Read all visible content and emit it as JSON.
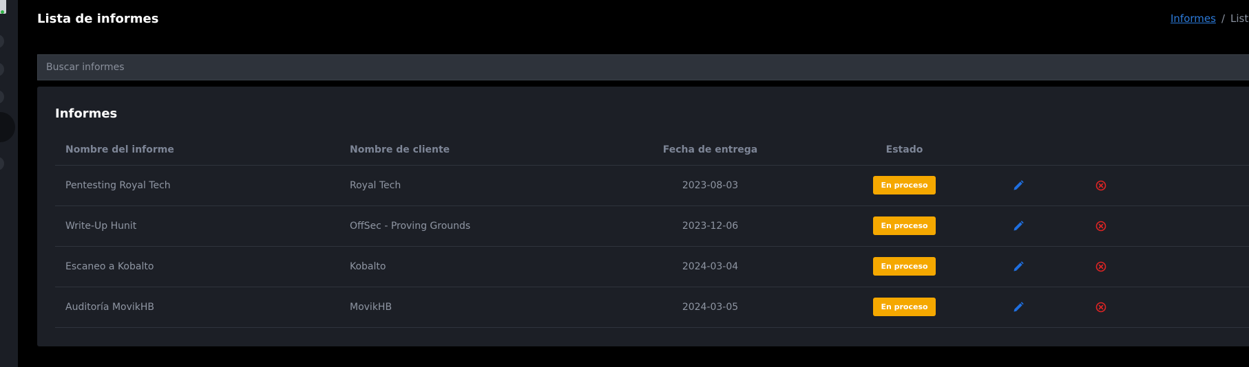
{
  "header": {
    "title": "Lista de informes",
    "breadcrumb": {
      "link": "Informes",
      "separator": "/",
      "current": "Lista"
    }
  },
  "search": {
    "placeholder": "Buscar informes",
    "value": ""
  },
  "card": {
    "title": "Informes",
    "columns": [
      "Nombre del informe",
      "Nombre de cliente",
      "Fecha de entrega",
      "Estado"
    ],
    "rows": [
      {
        "name": "Pentesting Royal Tech",
        "client": "Royal Tech",
        "date": "2023-08-03",
        "status": "En proceso"
      },
      {
        "name": "Write-Up Hunit",
        "client": "OffSec - Proving Grounds",
        "date": "2023-12-06",
        "status": "En proceso"
      },
      {
        "name": "Escaneo a Kobalto",
        "client": "Kobalto",
        "date": "2024-03-04",
        "status": "En proceso"
      },
      {
        "name": "Auditoría MovikHB",
        "client": "MovikHB",
        "date": "2024-03-05",
        "status": "En proceso"
      }
    ]
  },
  "icons": {
    "edit": "pencil-icon",
    "delete": "circle-x-icon"
  },
  "colors": {
    "status_badge": "#f5a800",
    "edit_icon": "#1f6fe0",
    "delete_icon": "#e02424",
    "link": "#2c7bdb"
  }
}
